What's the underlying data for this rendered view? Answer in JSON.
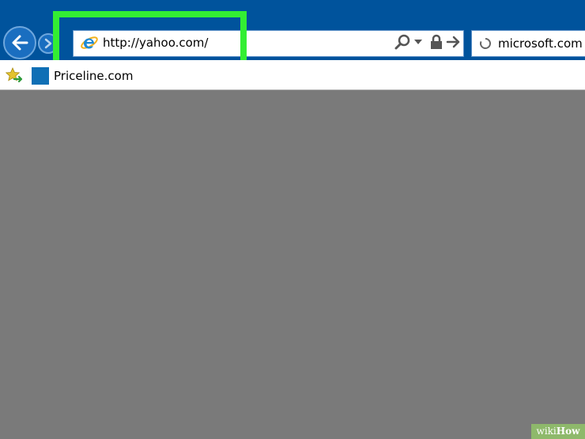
{
  "browser": {
    "address_bar": {
      "url": "http://yahoo.com/"
    },
    "tab": {
      "title": "microsoft.com"
    },
    "favorites": [
      {
        "label": "Priceline.com"
      }
    ]
  },
  "watermark": {
    "wiki": "wiki",
    "how": "How"
  },
  "colors": {
    "chrome": "#00539c",
    "highlight": "#33ee33",
    "page_background": "#7a7a7a"
  },
  "icons": [
    "back-arrow-icon",
    "forward-arrow-icon",
    "internet-explorer-icon",
    "search-icon",
    "chevron-down-icon",
    "lock-icon",
    "go-arrow-icon",
    "loading-spinner-icon",
    "add-favorite-icon",
    "priceline-icon"
  ]
}
